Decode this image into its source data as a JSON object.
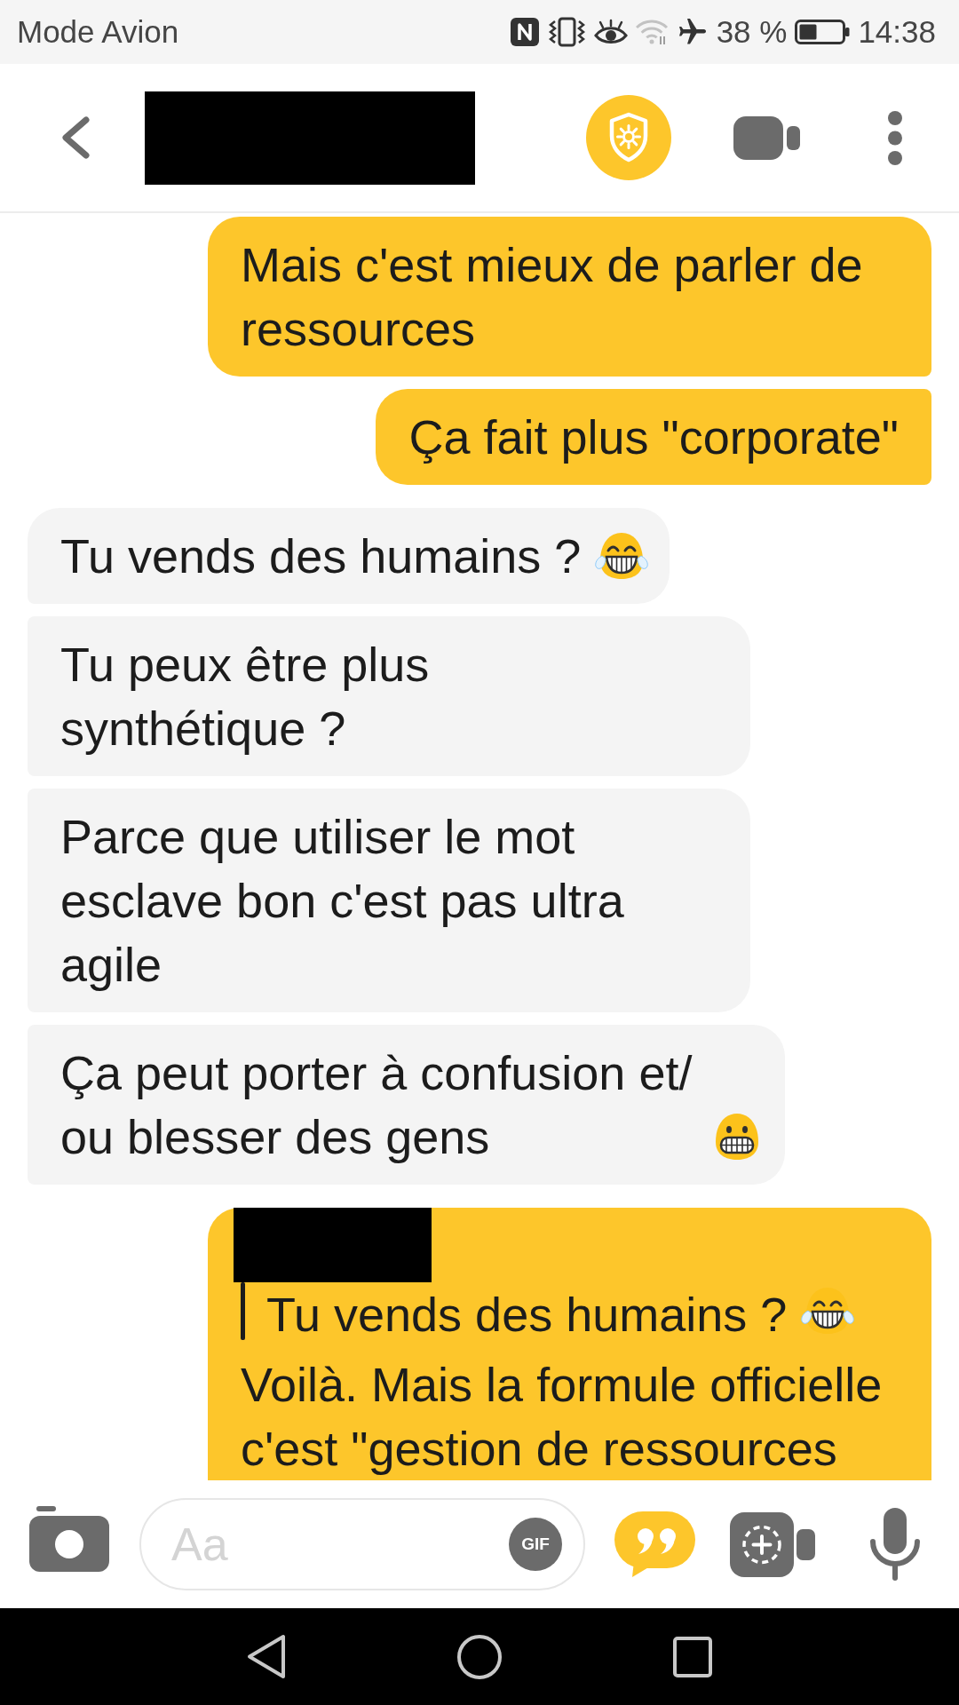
{
  "status_bar": {
    "network_text": "Mode Avion",
    "battery_text": "38 %",
    "time": "14:38"
  },
  "header": {
    "title_redacted": true
  },
  "messages": [
    {
      "kind": "sent",
      "text": "Mais c'est mieux de parler de ressources"
    },
    {
      "kind": "sent",
      "text": "Ça fait plus \"corporate\""
    },
    {
      "kind": "received",
      "text": "Tu vends des humains ?",
      "emoji": {
        "kind": "tears_of_joy"
      }
    },
    {
      "kind": "received",
      "text": "Tu peux être plus synthétique ?"
    },
    {
      "kind": "received",
      "text": "Parce que utiliser le mot esclave bon c'est pas ultra agile"
    },
    {
      "kind": "received",
      "text": "Ça peut porter à confusion et/​ou blesser des gens",
      "emoji": {
        "kind": "grimacing"
      }
    },
    {
      "kind": "sent",
      "reply_to": {
        "author_redacted": true,
        "text": "Tu vends des humains ?",
        "emoji": {
          "kind": "tears_of_joy"
        }
      },
      "text": "Voilà. Mais la formule officielle c'est \"gestion de ressources"
    }
  ],
  "composer": {
    "placeholder": "Aa",
    "gif_label": "GIF"
  }
}
